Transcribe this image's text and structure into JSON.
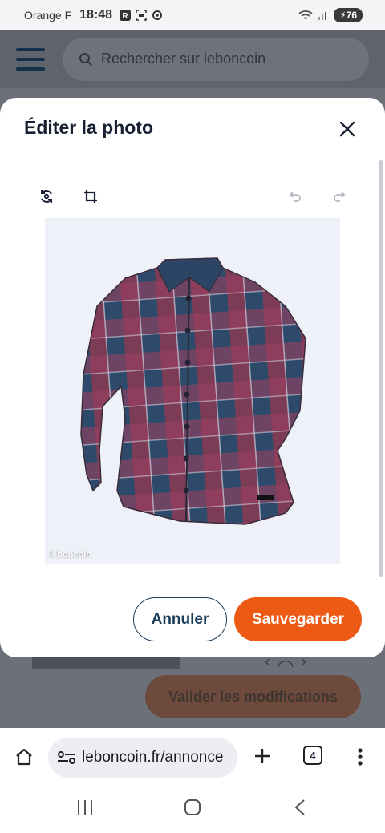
{
  "status_bar": {
    "carrier": "Orange F",
    "time": "18:48",
    "battery": "76"
  },
  "app_header": {
    "search_placeholder": "Rechercher sur leboncoin"
  },
  "background_page": {
    "validate_label": "Valider les modifications"
  },
  "modal": {
    "title": "Éditer la photo",
    "watermark": "leboncoin",
    "cancel_label": "Annuler",
    "save_label": "Sauvegarder"
  },
  "browser": {
    "url": "leboncoin.fr/annonce",
    "tab_count": "4"
  },
  "colors": {
    "accent_orange": "#ec5a13",
    "navy": "#1c3d5a"
  },
  "icons": [
    "menu-icon",
    "search-icon",
    "close-icon",
    "rotate-icon",
    "crop-icon",
    "undo-icon",
    "redo-icon",
    "home-icon",
    "site-settings-icon",
    "new-tab-icon",
    "tabs-icon",
    "more-icon",
    "recent-apps-icon",
    "home-nav-icon",
    "back-icon"
  ]
}
